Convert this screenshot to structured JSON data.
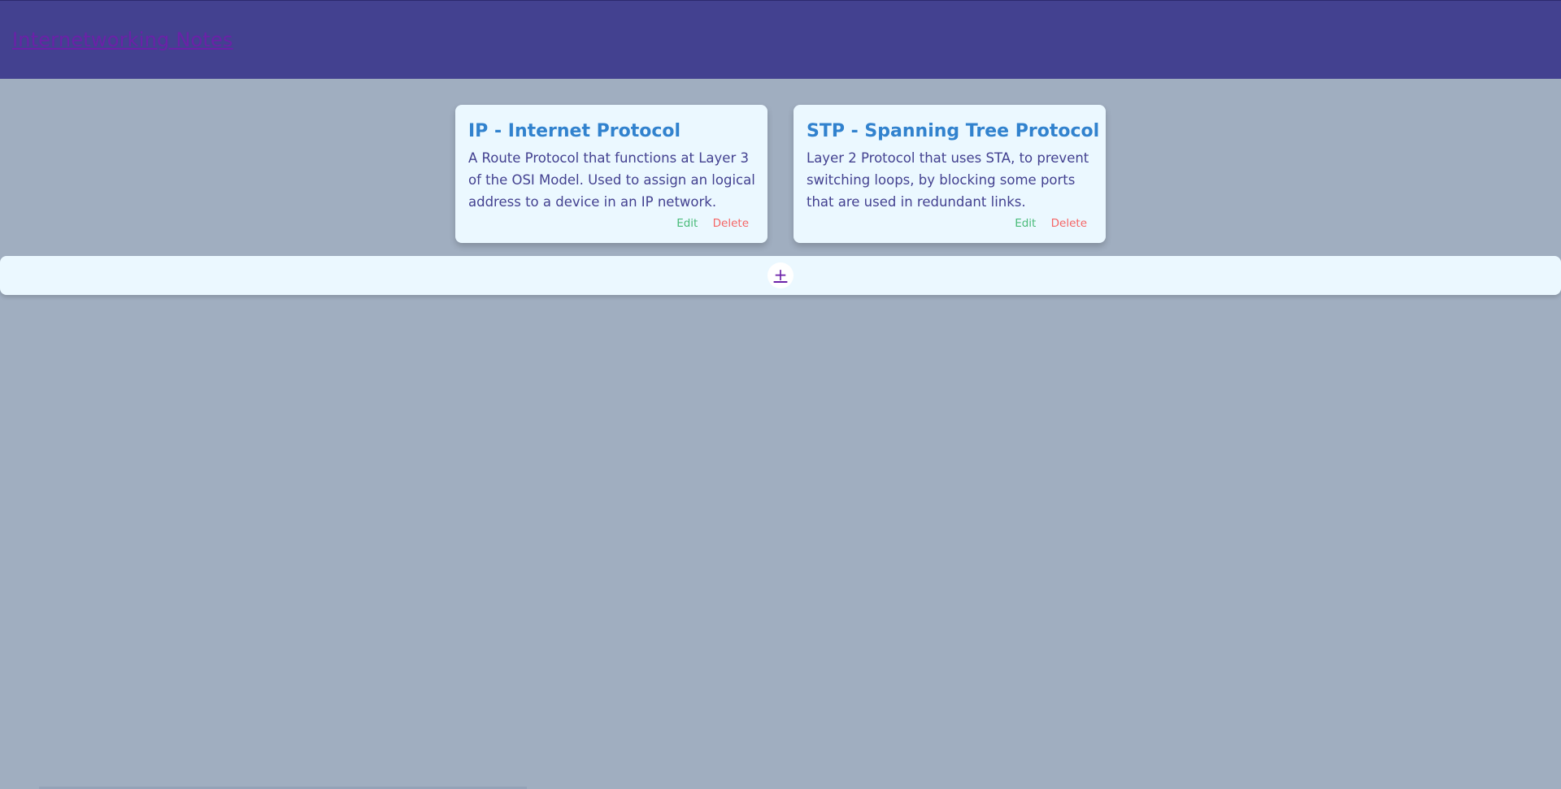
{
  "header": {
    "title": "Internetworking Notes"
  },
  "notes": [
    {
      "title": "IP - Internet Protocol",
      "body": "A Route Protocol that functions at Layer 3 of the OSI Model. Used to assign an logical address to a device in an IP network.",
      "edit_label": "Edit",
      "delete_label": "Delete"
    },
    {
      "title": "STP - Spanning Tree Protocol",
      "body": "Layer 2 Protocol that uses STA, to prevent switching loops, by blocking some ports that are used in redundant links.",
      "edit_label": "Edit",
      "delete_label": "Delete"
    }
  ],
  "add_bar": {
    "add_label": "+"
  },
  "colors": {
    "header_bg": "#434190",
    "page_bg": "#a0aec0",
    "card_bg": "#ebf8ff",
    "title": "#3182ce",
    "edit": "#48bb78",
    "delete": "#f56565"
  }
}
